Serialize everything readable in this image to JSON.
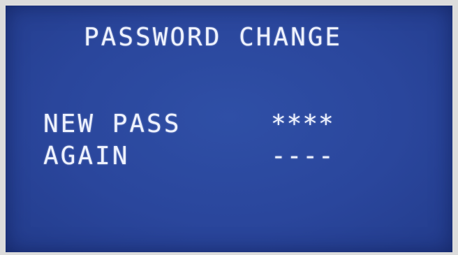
{
  "screen": {
    "title": "PASSWORD CHANGE",
    "fields": [
      {
        "label": "NEW PASS",
        "value": "****"
      },
      {
        "label": "AGAIN",
        "value": "----"
      }
    ]
  },
  "colors": {
    "background": "#2a469c",
    "text": "#eef2ff",
    "bezel": "#dcdcdc"
  }
}
